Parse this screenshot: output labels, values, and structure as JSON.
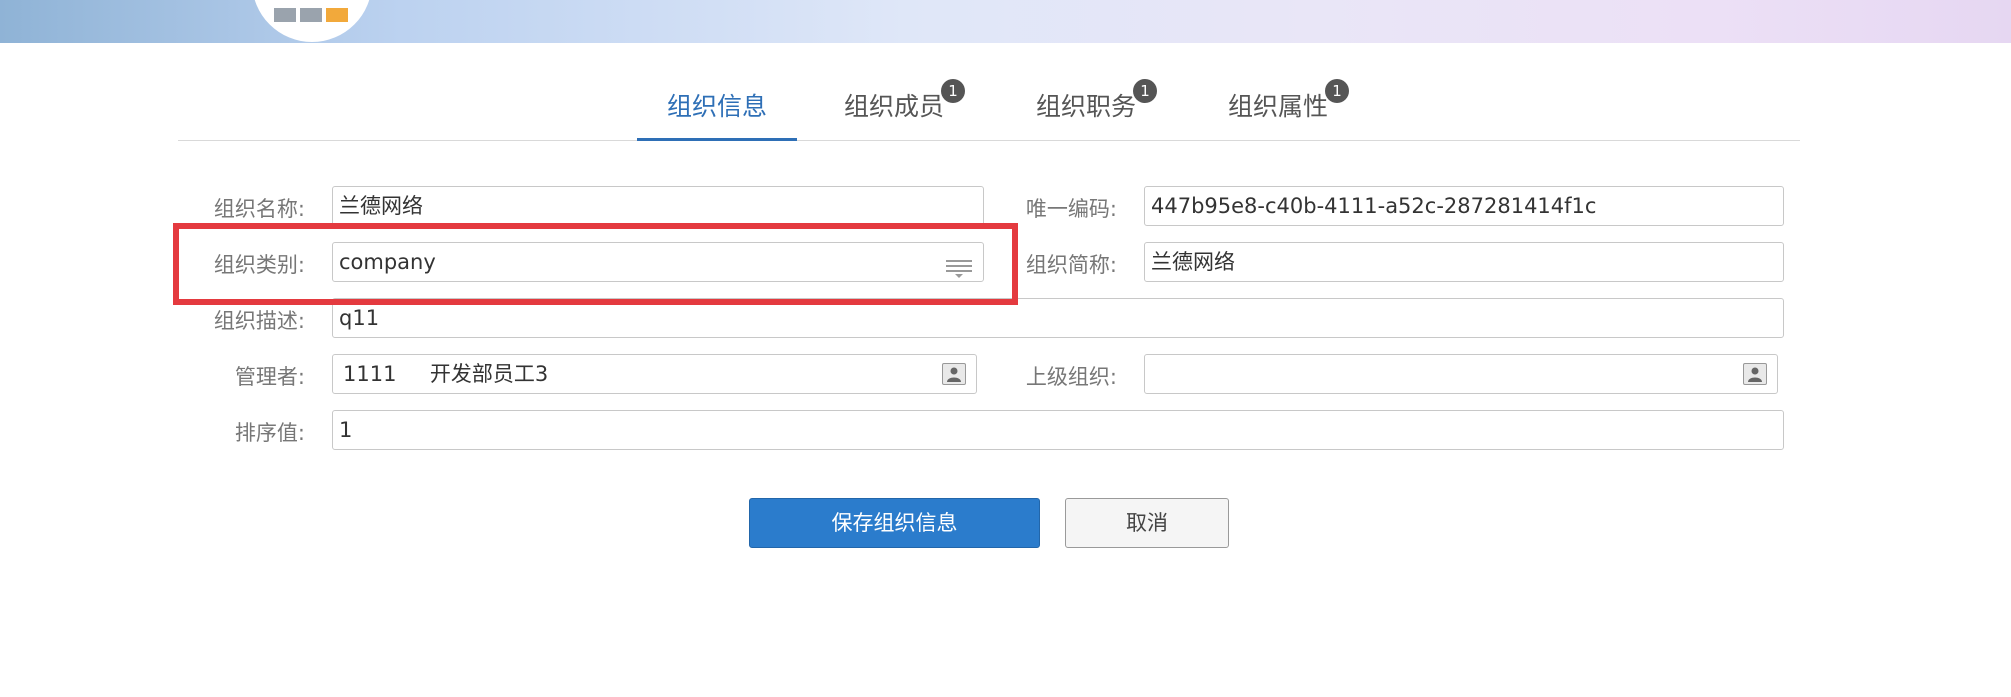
{
  "tabs": [
    {
      "label": "组织信息",
      "badge": ""
    },
    {
      "label": "组织成员",
      "badge": "1"
    },
    {
      "label": "组织职务",
      "badge": "1"
    },
    {
      "label": "组织属性",
      "badge": "1"
    }
  ],
  "form": {
    "org_name": {
      "label": "组织名称:",
      "value": "兰德网络"
    },
    "unique_code": {
      "label": "唯一编码:",
      "value": "447b95e8-c40b-4111-a52c-287281414f1c"
    },
    "org_type": {
      "label": "组织类别:",
      "value": "company"
    },
    "short_name": {
      "label": "组织简称:",
      "value": "兰德网络"
    },
    "description": {
      "label": "组织描述:",
      "value": "q11"
    },
    "manager": {
      "label": "管理者:",
      "value": "1111     开发部员工3"
    },
    "parent_org": {
      "label": "上级组织:",
      "value": ""
    },
    "sort_value": {
      "label": "排序值:",
      "value": "1"
    }
  },
  "buttons": {
    "save": "保存组织信息",
    "cancel": "取消"
  },
  "colors": {
    "accent": "#2e6fb6",
    "primary_button": "#2b7ccc",
    "highlight": "#e43a3f"
  },
  "icons": {
    "select": "list-dropdown-icon",
    "picker": "person-picker-icon"
  }
}
